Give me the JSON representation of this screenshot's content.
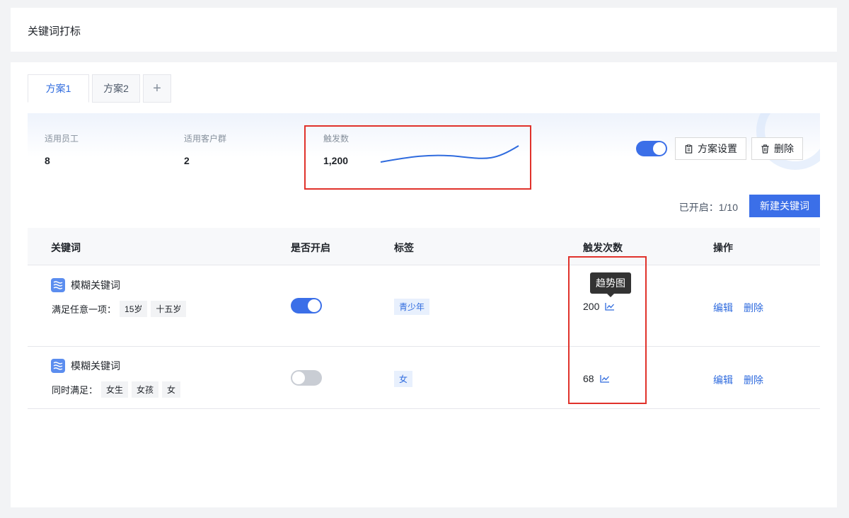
{
  "page": {
    "title": "关键词打标"
  },
  "tabs": [
    {
      "label": "方案1",
      "active": true
    },
    {
      "label": "方案2",
      "active": false
    }
  ],
  "summary": {
    "staff": {
      "label": "适用员工",
      "value": "8"
    },
    "groups": {
      "label": "适用客户群",
      "value": "2"
    },
    "triggers": {
      "label": "触发数",
      "value": "1,200"
    },
    "enabled": true,
    "settings_label": "方案设置",
    "delete_label": "删除"
  },
  "toolbar": {
    "opened_text": "已开启：1/10",
    "new_keyword_label": "新建关键词"
  },
  "table": {
    "headers": [
      "关键词",
      "是否开启",
      "标签",
      "触发次数",
      "操作"
    ],
    "rows": [
      {
        "keyword": "模糊关键词",
        "condition": "满足任意一项：",
        "chips": [
          "15岁",
          "十五岁"
        ],
        "enabled": true,
        "tag": "青少年",
        "count": "200",
        "actions": [
          "编辑",
          "删除"
        ]
      },
      {
        "keyword": "模糊关键词",
        "condition": "同时满足：",
        "chips": [
          "女生",
          "女孩",
          "女"
        ],
        "enabled": false,
        "tag": "女",
        "count": "68",
        "actions": [
          "编辑",
          "删除"
        ]
      }
    ]
  },
  "tooltip": {
    "text": "趋势图"
  },
  "colors": {
    "primary": "#3b6fe8",
    "highlight": "#e0322b",
    "link": "#2f6bde"
  }
}
